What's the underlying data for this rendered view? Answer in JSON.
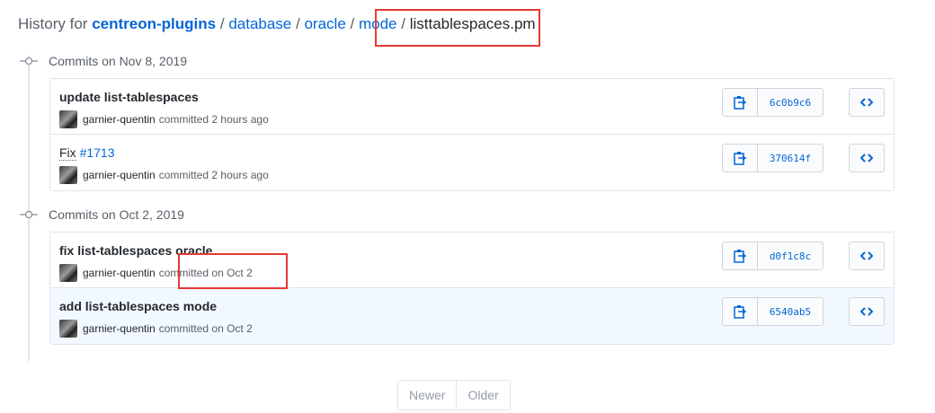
{
  "breadcrumb": {
    "prefix": "History for",
    "repo": "centreon-plugins",
    "sep": "/",
    "path1": "database",
    "path2": "oracle",
    "path3": "mode",
    "file": "listtablespaces.pm"
  },
  "groups": [
    {
      "title": "Commits on Nov 8, 2019",
      "commits": [
        {
          "title": "update list-tablespaces",
          "author": "garnier-quentin",
          "meta": "committed 2 hours ago",
          "sha": "6c0b9c6"
        },
        {
          "title_prefix": "Fix",
          "issue": "#1713",
          "author": "garnier-quentin",
          "meta": "committed 2 hours ago",
          "sha": "370614f"
        }
      ]
    },
    {
      "title": "Commits on Oct 2, 2019",
      "commits": [
        {
          "title": "fix list-tablespaces oracle",
          "author": "garnier-quentin",
          "meta": "committed on Oct 2",
          "sha": "d0f1c8c"
        },
        {
          "title": "add list-tablespaces mode",
          "author": "garnier-quentin",
          "meta": "committed on Oct 2",
          "sha": "6540ab5"
        }
      ]
    }
  ],
  "pagination": {
    "newer": "Newer",
    "older": "Older"
  },
  "colors": {
    "link": "#0366d6",
    "highlight": "#f1f8ff",
    "annotation": "#e53935"
  },
  "icons": {
    "commit": "git-commit-icon",
    "copy": "clipboard-icon",
    "browse": "code-icon"
  }
}
